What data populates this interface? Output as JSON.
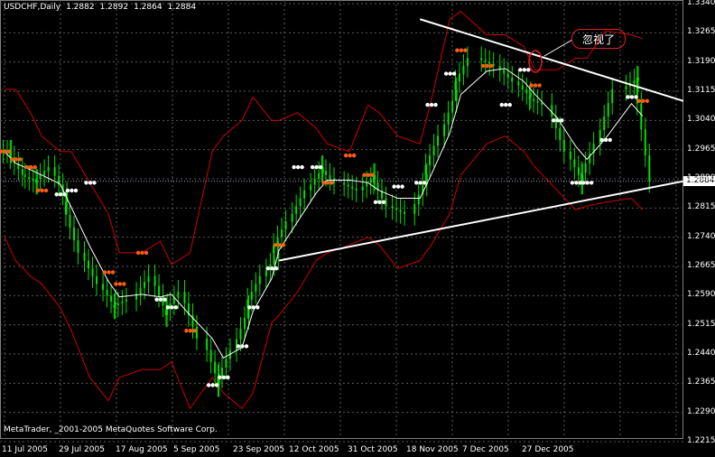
{
  "header": {
    "symbol": "USDCHF,Daily",
    "open": "1.2882",
    "high": "1.2892",
    "low": "1.2864",
    "close": "1.2884"
  },
  "footer": {
    "copyright": "MetaTrader, _2001-2005 MetaQuotes Software Corp."
  },
  "annotation": {
    "text": "忽视了"
  },
  "current_price_label": "1.2884",
  "colors": {
    "background": "#000000",
    "grid": "#5a5a5a",
    "candle": "#00e000",
    "bands": "#cc0000",
    "sar_bear": "#ff5a14",
    "sar_bull": "#ffffff",
    "trendlines": "#ffffff"
  },
  "chart_data": {
    "type": "candlestick",
    "symbol": "USDCHF",
    "timeframe": "Daily",
    "y_ticks": [
      "1.3340",
      "1.3265",
      "1.3190",
      "1.3115",
      "1.3040",
      "1.2965",
      "1.2890",
      "1.2815",
      "1.2740",
      "1.2665",
      "1.2590",
      "1.2515",
      "1.2440",
      "1.2365",
      "1.2290",
      "1.2215"
    ],
    "ylim": [
      1.2215,
      1.334
    ],
    "x_ticks": [
      "11 Jul 2005",
      "29 Jul 2005",
      "17 Aug 2005",
      "5 Sep 2005",
      "23 Sep 2005",
      "12 Oct 2005",
      "31 Oct 2005",
      "18 Nov 2005",
      "7 Dec 2005",
      "27 Dec 2005"
    ],
    "x": [
      "2005-07-11",
      "2005-07-14",
      "2005-07-18",
      "2005-07-21",
      "2005-07-26",
      "2005-07-29",
      "2005-08-03",
      "2005-08-08",
      "2005-08-11",
      "2005-08-17",
      "2005-08-22",
      "2005-08-25",
      "2005-08-30",
      "2005-09-05",
      "2005-09-08",
      "2005-09-13",
      "2005-09-16",
      "2005-09-21",
      "2005-09-23",
      "2005-09-28",
      "2005-10-03",
      "2005-10-06",
      "2005-10-12",
      "2005-10-17",
      "2005-10-20",
      "2005-10-25",
      "2005-10-31",
      "2005-11-03",
      "2005-11-08",
      "2005-11-11",
      "2005-11-18",
      "2005-11-23",
      "2005-11-28",
      "2005-12-01",
      "2005-12-07",
      "2005-12-12",
      "2005-12-15",
      "2005-12-20",
      "2005-12-27",
      "2005-12-30"
    ],
    "close": [
      1.296,
      1.29,
      1.288,
      1.292,
      1.283,
      1.27,
      1.262,
      1.256,
      1.258,
      1.264,
      1.254,
      1.26,
      1.248,
      1.236,
      1.245,
      1.256,
      1.264,
      1.27,
      1.278,
      1.286,
      1.292,
      1.288,
      1.286,
      1.29,
      1.282,
      1.28,
      1.29,
      1.3,
      1.312,
      1.32,
      1.318,
      1.314,
      1.31,
      1.308,
      1.296,
      1.288,
      1.298,
      1.312,
      1.315,
      1.2884
    ],
    "sar_points": [
      1.296,
      1.294,
      1.292,
      1.286,
      1.285,
      1.286,
      1.288,
      1.265,
      1.262,
      1.27,
      1.258,
      1.256,
      1.25,
      1.236,
      1.238,
      1.246,
      1.256,
      1.266,
      1.272,
      1.292,
      1.292,
      1.288,
      1.295,
      1.29,
      1.283,
      1.287,
      1.288,
      1.308,
      1.316,
      1.322,
      1.318,
      1.308,
      1.317,
      1.313,
      1.304,
      1.288,
      1.288,
      1.299,
      1.31,
      1.309
    ],
    "sar_side": [
      "bear",
      "bear",
      "bear",
      "bear",
      "bull",
      "bull",
      "bull",
      "bear",
      "bear",
      "bear",
      "bull",
      "bull",
      "bear",
      "bull",
      "bull",
      "bull",
      "bull",
      "bull",
      "bear",
      "bull",
      "bull",
      "bear",
      "bear",
      "bear",
      "bull",
      "bull",
      "bull",
      "bull",
      "bull",
      "bear",
      "bear",
      "bull",
      "bull",
      "bear",
      "bull",
      "bull",
      "bull",
      "bull",
      "bull",
      "bear"
    ],
    "bands_upper": [
      1.312,
      1.312,
      1.306,
      1.3,
      1.296,
      1.296,
      1.288,
      1.28,
      1.27,
      1.27,
      1.273,
      1.267,
      1.27,
      1.296,
      1.3,
      1.304,
      1.31,
      1.304,
      1.304,
      1.306,
      1.302,
      1.298,
      1.296,
      1.308,
      1.306,
      1.3,
      1.298,
      1.309,
      1.33,
      1.332,
      1.326,
      1.326,
      1.323,
      1.317,
      1.317,
      1.32,
      1.32,
      1.327,
      1.326,
      1.325
    ],
    "bands_lower": [
      1.274,
      1.268,
      1.264,
      1.262,
      1.256,
      1.25,
      1.238,
      1.232,
      1.238,
      1.24,
      1.24,
      1.242,
      1.23,
      1.238,
      1.234,
      1.23,
      1.234,
      1.252,
      1.254,
      1.26,
      1.268,
      1.27,
      1.272,
      1.274,
      1.272,
      1.266,
      1.268,
      1.272,
      1.28,
      1.29,
      1.298,
      1.3,
      1.296,
      1.292,
      1.286,
      1.281,
      1.282,
      1.283,
      1.284,
      1.281
    ],
    "trendlines": [
      {
        "from": {
          "x": "2005-10-31",
          "y": 1.33
        },
        "to": {
          "x": "2006-01-10",
          "y": 1.309
        }
      },
      {
        "from": {
          "x": "2005-09-23",
          "y": 1.268
        },
        "to": {
          "x": "2006-01-10",
          "y": 1.2884
        }
      }
    ],
    "current_price": 1.2884,
    "grid": true
  }
}
